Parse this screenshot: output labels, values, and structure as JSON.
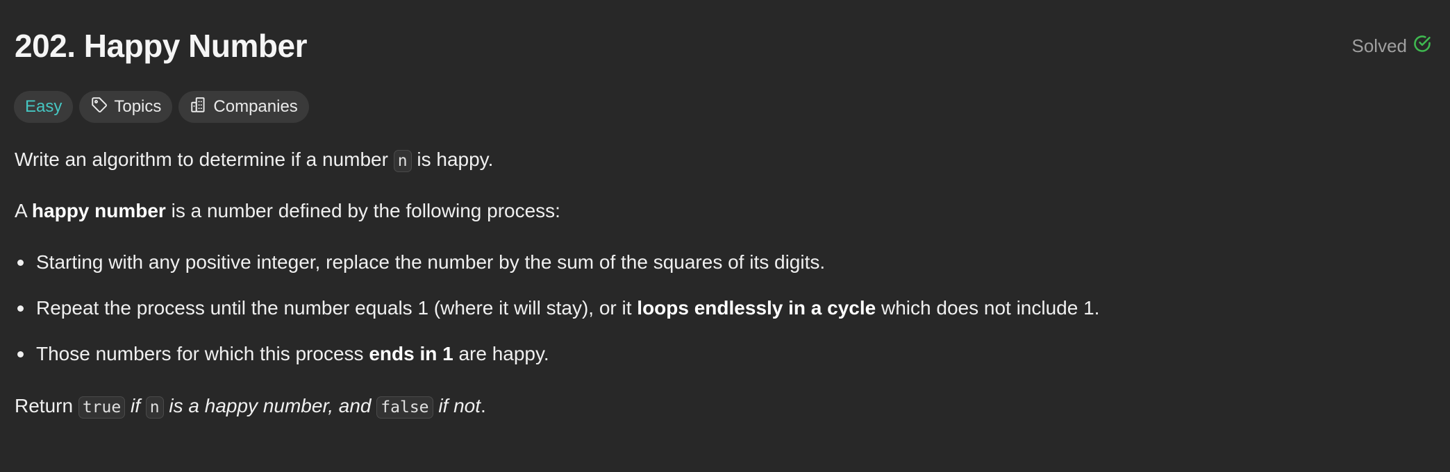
{
  "problem": {
    "title": "202. Happy Number",
    "status": "Solved",
    "status_color": "#3fb950",
    "difficulty": "Easy",
    "difficulty_color": "#46c6c2",
    "tags": [
      {
        "label": "Topics",
        "icon": "tag-icon"
      },
      {
        "label": "Companies",
        "icon": "building-icon"
      }
    ]
  },
  "description": {
    "p1": {
      "before": "Write an algorithm to determine if a number ",
      "code": "n",
      "after": " is happy."
    },
    "p2": {
      "before": "A ",
      "bold": "happy number",
      "after": " is a number defined by the following process:"
    },
    "bullets": {
      "b1": "Starting with any positive integer, replace the number by the sum of the squares of its digits.",
      "b2_before": "Repeat the process until the number equals 1 (where it will stay), or it ",
      "b2_bold": "loops endlessly in a cycle",
      "b2_after": " which does not include 1.",
      "b3_before": "Those numbers for which this process ",
      "b3_bold": "ends in 1",
      "b3_after": " are happy."
    },
    "p4": {
      "before": "Return ",
      "code_true": "true",
      "mid1": " if ",
      "code_n": "n",
      "mid2": " is a happy number, and ",
      "code_false": "false",
      "mid3": " if not",
      "end": "."
    }
  }
}
